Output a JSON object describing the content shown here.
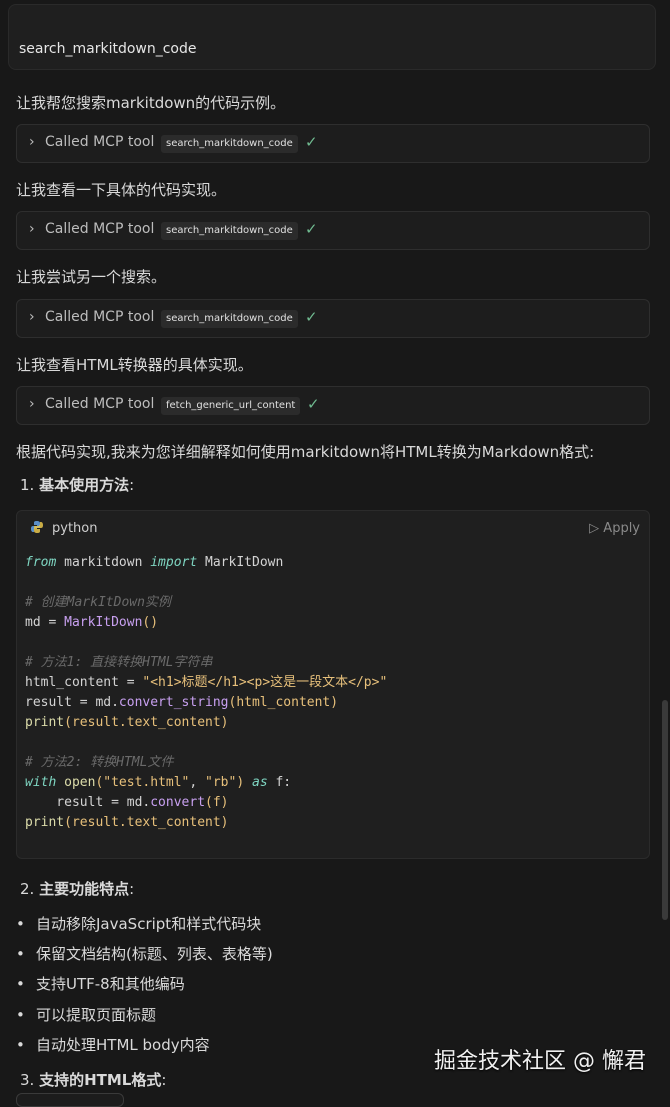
{
  "query": "search_markitdown_code",
  "messages": [
    "让我帮您搜索markitdown的代码示例。",
    "让我查看一下具体的代码实现。",
    "让我尝试另一个搜索。",
    "让我查看HTML转换器的具体实现。"
  ],
  "tool_calls": [
    {
      "label": "Called MCP tool",
      "tool": "search_markitdown_code"
    },
    {
      "label": "Called MCP tool",
      "tool": "search_markitdown_code"
    },
    {
      "label": "Called MCP tool",
      "tool": "search_markitdown_code"
    },
    {
      "label": "Called MCP tool",
      "tool": "fetch_generic_url_content"
    }
  ],
  "intro": "根据代码实现,我来为您详细解释如何使用markitdown将HTML转换为Markdown格式:",
  "section1": {
    "num": "1. ",
    "title": "基本使用方法",
    "colon": ":"
  },
  "code": {
    "language": "python",
    "apply_label": "Apply",
    "l1_from": "from",
    "l1_mod": " markitdown ",
    "l1_import": "import",
    "l1_cls": " MarkItDown",
    "l3": "# 创建MarkItDown实例",
    "l4_var": "md = ",
    "l4_cls": "MarkItDown",
    "l4_paren": "()",
    "l6": "# 方法1: 直接转换HTML字符串",
    "l7_var": "html_content = ",
    "l7_str": "\"<h1>标题</h1><p>这是一段文本</p>\"",
    "l8_var": "result = md.",
    "l8_fn": "convert_string",
    "l8_arg": "(html_content)",
    "l9_fn": "print",
    "l9_arg": "(result.text_content)",
    "l11": "# 方法2: 转换HTML文件",
    "l12_with": "with",
    "l12_open": " open",
    "l12_p1": "(",
    "l12_s1": "\"test.html\"",
    "l12_comma": ", ",
    "l12_s2": "\"rb\"",
    "l12_p2": ") ",
    "l12_as": "as",
    "l12_f": " f:",
    "l13_var": "    result = md.",
    "l13_fn": "convert",
    "l13_arg": "(f)",
    "l14_fn": "print",
    "l14_arg": "(result.text_content)"
  },
  "section2": {
    "num": "2. ",
    "title": "主要功能特点",
    "colon": ":"
  },
  "bullets": [
    "自动移除JavaScript和样式代码块",
    "保留文档结构(标题、列表、表格等)",
    "支持UTF-8和其他编码",
    "可以提取页面标题",
    "自动处理HTML body内容"
  ],
  "section3": {
    "num": "3. ",
    "title": "支持的HTML格式",
    "colon": ":"
  },
  "watermark": "掘金技术社区 @ 懈君"
}
